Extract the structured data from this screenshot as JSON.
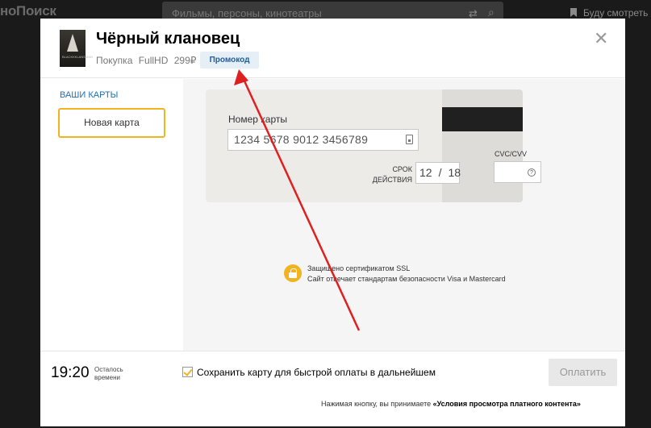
{
  "site": {
    "logo": "нoПоиск",
    "search_placeholder": "Фильмы, персоны, кинотеатры",
    "watchlist_label": "Буду смотреть"
  },
  "modal": {
    "poster_text": "BLACKKKLANSMAN",
    "title": "Чёрный клановец",
    "purchase_label": "Покупка",
    "quality": "FullHD",
    "price": "299₽",
    "promo_label": "Промокод",
    "close_symbol": "✕"
  },
  "sidebar": {
    "title": "ВАШИ КАРТЫ",
    "new_card_label": "Новая карта"
  },
  "card": {
    "number_label": "Номер карты",
    "number_value": "1234 5678 9012 3456789",
    "expiry_label_line1": "СРОК",
    "expiry_label_line2": "ДЕЙСТВИЯ",
    "expiry_month": "12",
    "expiry_sep": "/",
    "expiry_year": "18",
    "cvc_label": "CVC/CVV",
    "cvc_value": "",
    "cvc_help_icon": "?"
  },
  "security": {
    "line1": "Защищено сертификатом SSL",
    "line2": "Сайт отвечает стандартам безопасности Visa и Mastercard"
  },
  "footer": {
    "timer": "19:20",
    "timer_label_line1": "Осталось",
    "timer_label_line2": "времени",
    "save_card_label": "Сохранить карту для быстрой оплаты в дальнейшем",
    "save_card_checked": true,
    "pay_label": "Оплатить",
    "terms_prefix": "Нажимая кнопку, вы принимаете ",
    "terms_link": "«Условия просмотра платного контента»"
  },
  "colors": {
    "accent_yellow": "#f2b321",
    "link_blue": "#1c6fb5",
    "annotation_arrow": "#e02020"
  }
}
